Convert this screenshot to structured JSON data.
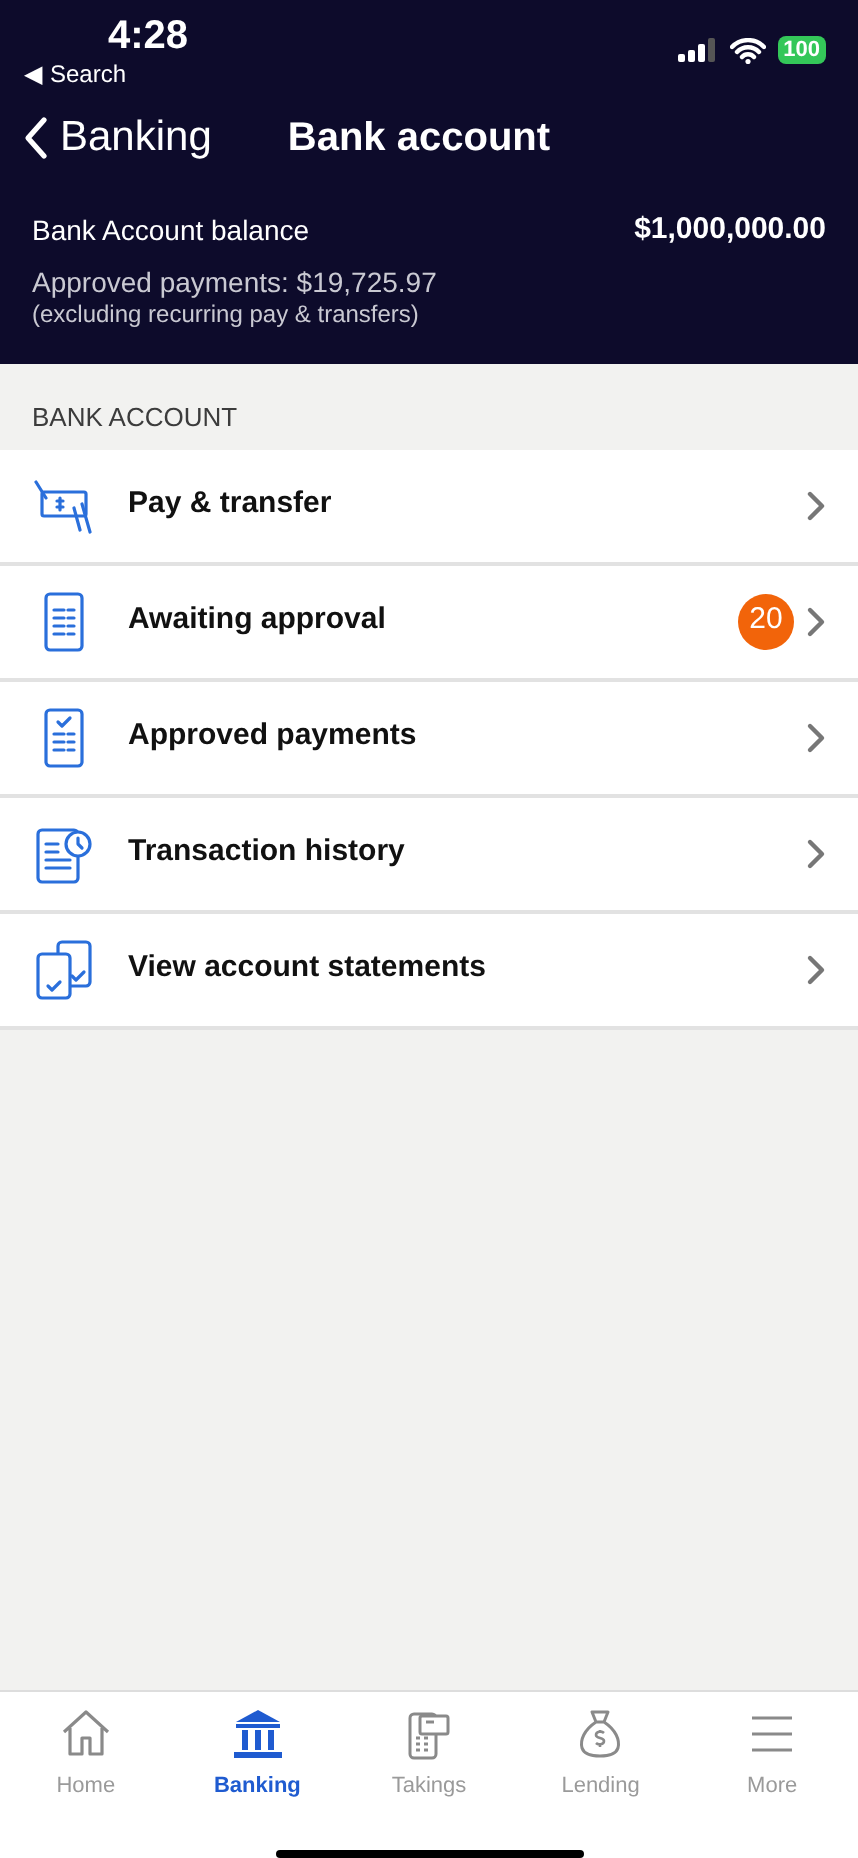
{
  "status_bar": {
    "time": "4:28",
    "back_arrow": "◀",
    "back_label": "Search",
    "battery": "100"
  },
  "nav_bar": {
    "back_label": "Banking",
    "title": "Bank account"
  },
  "summary": {
    "balance_label": "Bank Account balance",
    "balance": "$1,000,000.00",
    "approved": "Approved payments: $19,725.97",
    "note": "(excluding recurring pay & transfers)"
  },
  "section": {
    "title": "BANK ACCOUNT"
  },
  "menu": [
    {
      "label": "Pay & transfer"
    },
    {
      "label": "Awaiting approval",
      "badge": "20"
    },
    {
      "label": "Approved payments"
    },
    {
      "label": "Transaction history"
    },
    {
      "label": "View account statements"
    }
  ],
  "tabs": [
    {
      "label": "Home",
      "selected": false
    },
    {
      "label": "Banking",
      "selected": true
    },
    {
      "label": "Takings",
      "selected": false
    },
    {
      "label": "Lending",
      "selected": false
    },
    {
      "label": "More",
      "selected": false
    }
  ]
}
